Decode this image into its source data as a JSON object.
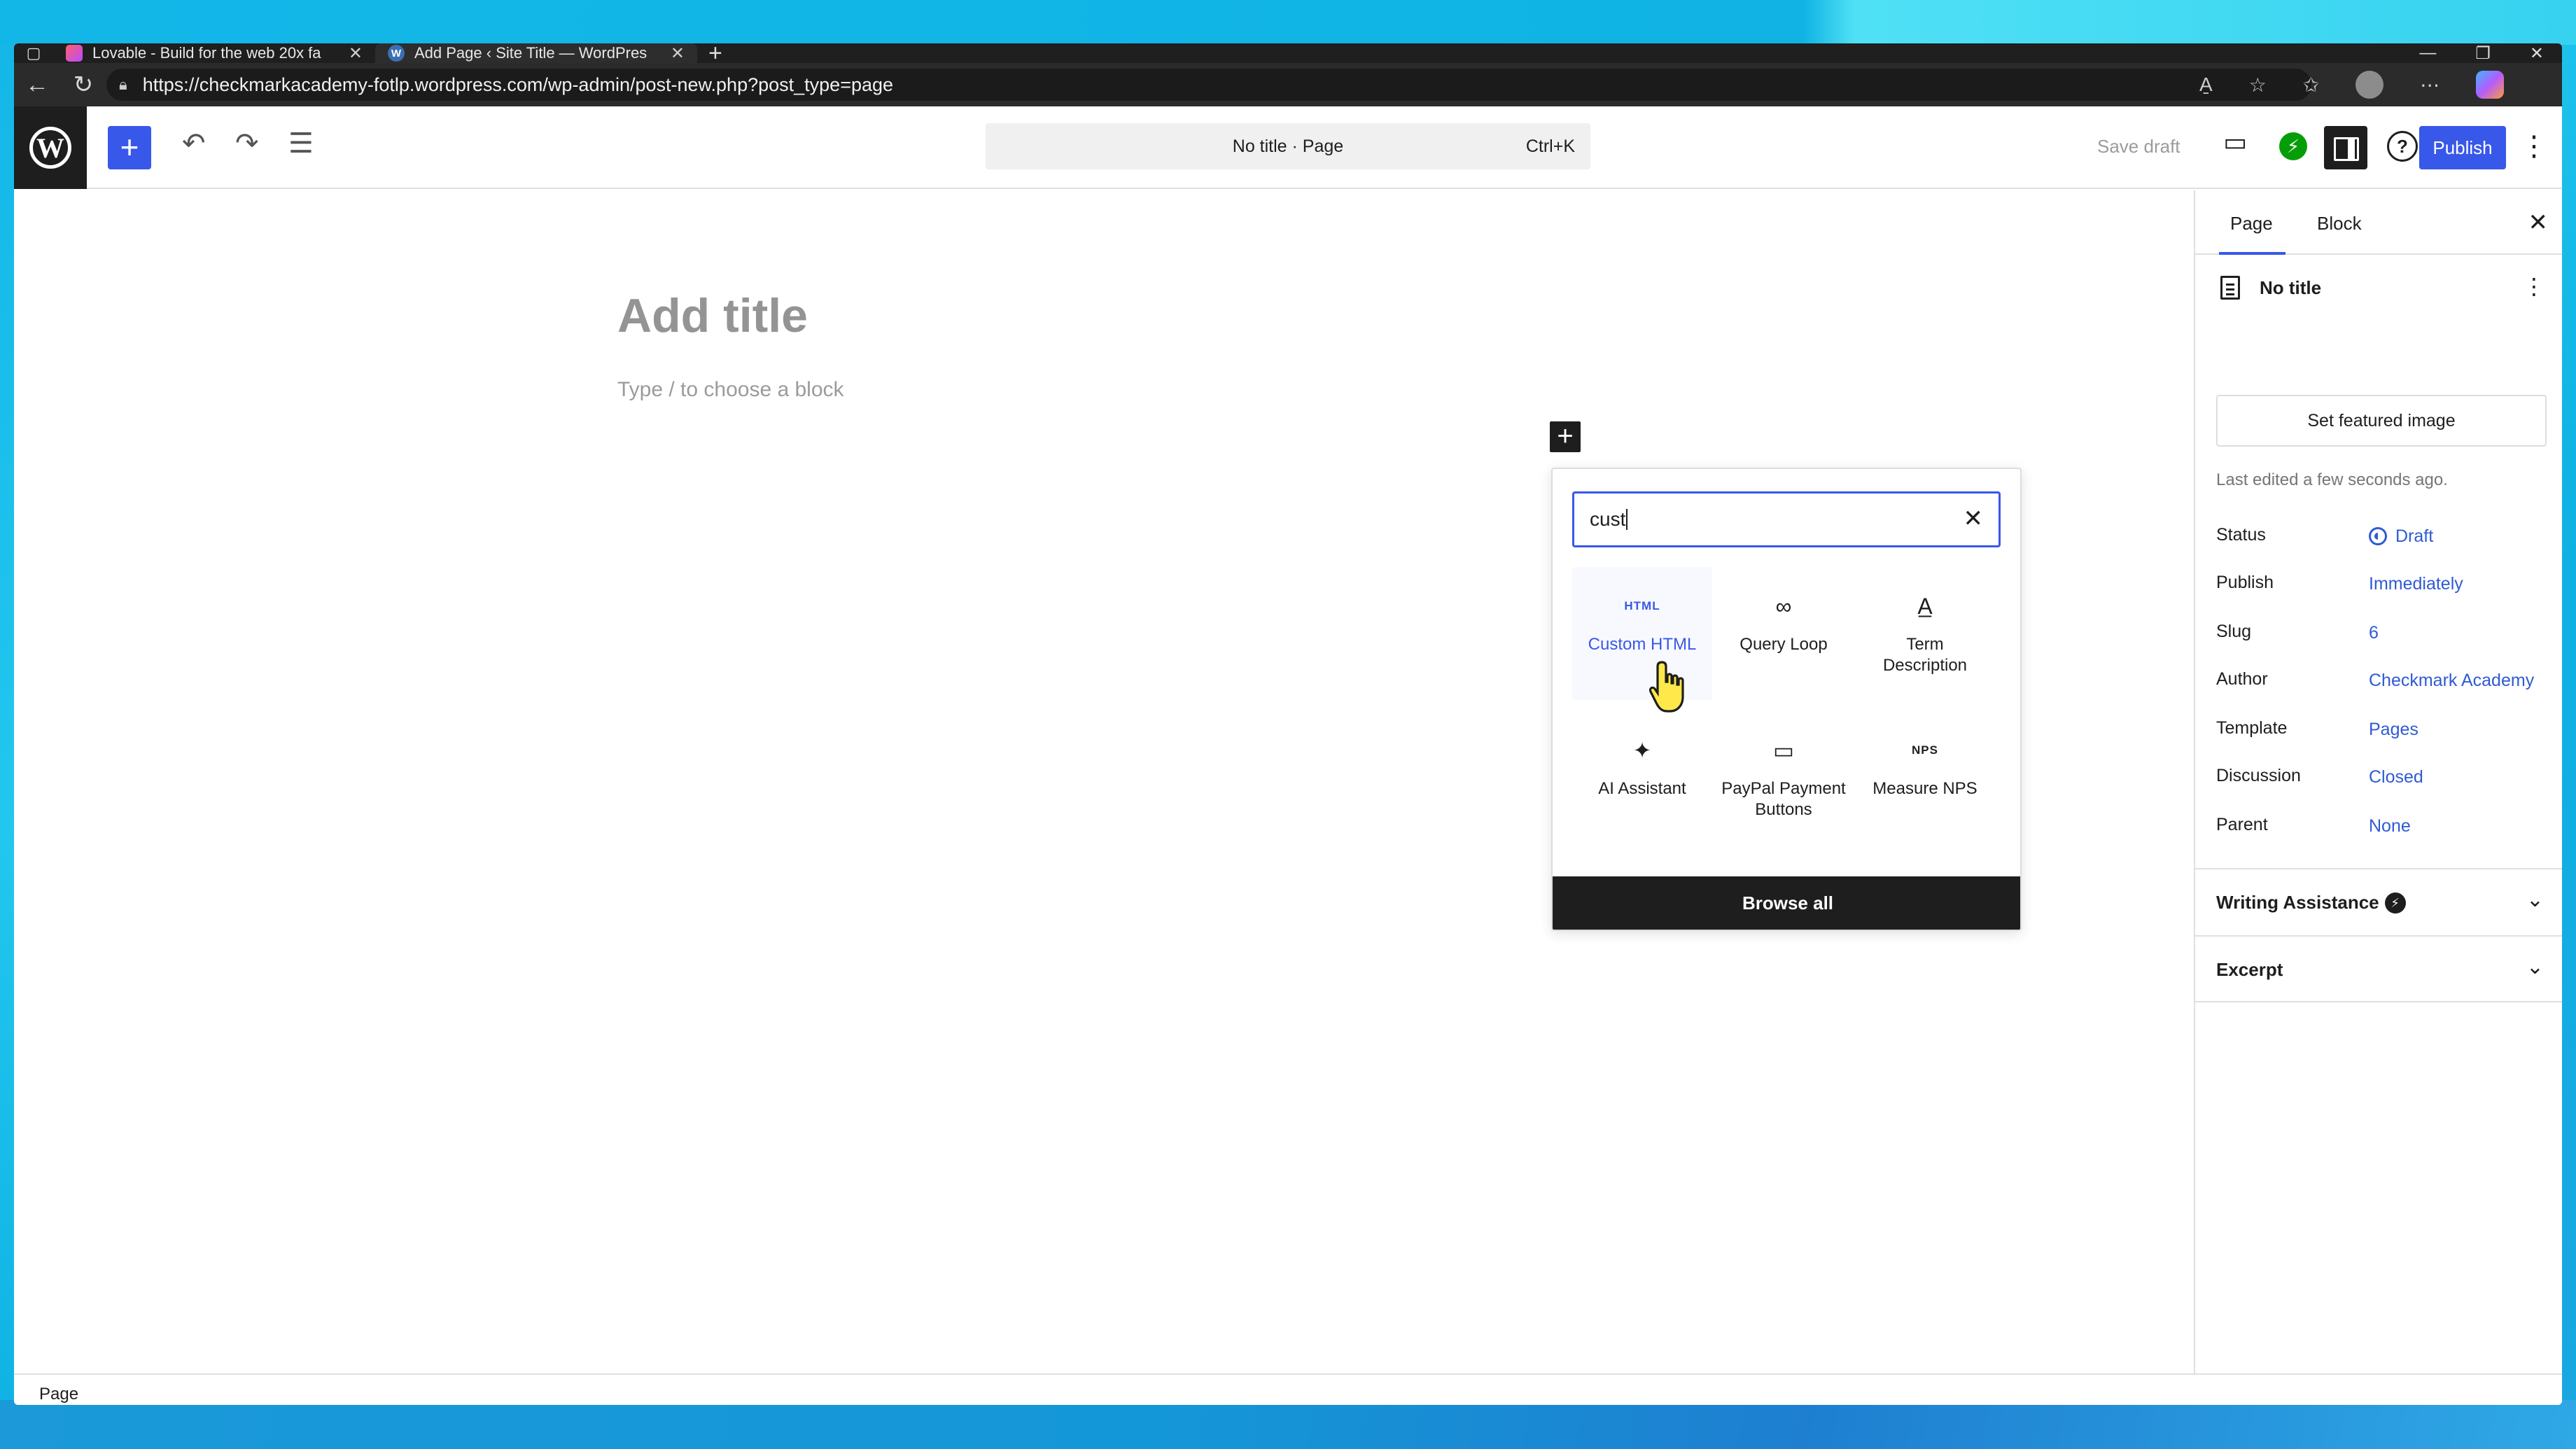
{
  "browser": {
    "tabs": [
      {
        "title": "Lovable - Build for the web 20x fa",
        "close": "✕"
      },
      {
        "title": "Add Page ‹ Site Title — WordPres",
        "close": "✕"
      }
    ],
    "new_tab": "+",
    "url": "https://checkmarkacademy-fotlp.wordpress.com/wp-admin/post-new.php?post_type=page"
  },
  "toolbar": {
    "add_block": "+",
    "command_title": "No title · Page",
    "command_shortcut": "Ctrl+K",
    "save_draft": "Save draft",
    "publish": "Publish"
  },
  "editor": {
    "title_placeholder": "Add title",
    "paragraph_placeholder": "Type / to choose a block",
    "plus": "+"
  },
  "inserter": {
    "search_value": "cust",
    "clear": "✕",
    "blocks": [
      {
        "label": "Custom HTML",
        "icon": "HTML",
        "icon_name": "html-icon"
      },
      {
        "label": "Query Loop",
        "icon": "∞",
        "icon_name": "loop-icon"
      },
      {
        "label": "Term Description",
        "icon": "A̲",
        "icon_name": "term-description-icon"
      },
      {
        "label": "AI Assistant",
        "icon": "✦",
        "icon_name": "sparkle-icon"
      },
      {
        "label": "PayPal Payment Buttons",
        "icon": "▭",
        "icon_name": "card-icon"
      },
      {
        "label": "Measure NPS",
        "icon": "NPS",
        "icon_name": "nps-icon"
      }
    ],
    "browse_all": "Browse all"
  },
  "sidebar": {
    "tabs": [
      "Page",
      "Block"
    ],
    "close": "✕",
    "doc_title": "No title",
    "featured_image": "Set featured image",
    "last_edited": "Last edited a few seconds ago.",
    "meta": [
      {
        "label": "Status",
        "value": "Draft"
      },
      {
        "label": "Publish",
        "value": "Immediately"
      },
      {
        "label": "Slug",
        "value": "6"
      },
      {
        "label": "Author",
        "value": "Checkmark Academy"
      },
      {
        "label": "Template",
        "value": "Pages"
      },
      {
        "label": "Discussion",
        "value": "Closed"
      },
      {
        "label": "Parent",
        "value": "None"
      }
    ],
    "panels": [
      {
        "title": "Writing Assistance"
      },
      {
        "title": "Excerpt"
      }
    ]
  },
  "footer": {
    "breadcrumb": "Page"
  },
  "colors": {
    "accent": "#3858e9",
    "dark": "#1e1e1e",
    "link": "#2f5bd3",
    "jetpack": "#069e08"
  }
}
